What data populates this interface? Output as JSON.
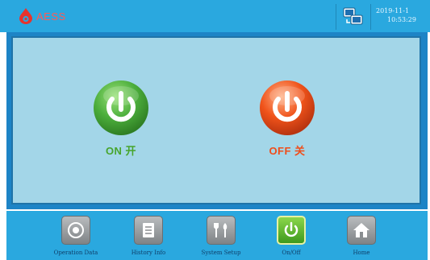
{
  "header": {
    "brand": "AESS",
    "datetime_line1": "2019-11-1",
    "datetime_line2": "10:53:29",
    "network_icon": "network-status-icon"
  },
  "main": {
    "on_button": {
      "label": "ON 开",
      "icon": "power-icon",
      "color": "#4cae3c"
    },
    "off_button": {
      "label": "OFF 关",
      "icon": "power-icon",
      "color": "#f0531a"
    }
  },
  "nav": {
    "items": [
      {
        "label": "Operation Data",
        "icon": "operation-data-icon",
        "active": false
      },
      {
        "label": "History Info",
        "icon": "history-info-icon",
        "active": false
      },
      {
        "label": "System Setup",
        "icon": "system-setup-icon",
        "active": false
      },
      {
        "label": "On/Off",
        "icon": "power-icon",
        "active": true
      },
      {
        "label": "Home",
        "icon": "home-icon",
        "active": false
      }
    ]
  },
  "colors": {
    "bar": "#2aa8df",
    "panel_bg": "#a3d6e8",
    "on_label": "#47a52c",
    "off_label": "#ef4d1a"
  }
}
